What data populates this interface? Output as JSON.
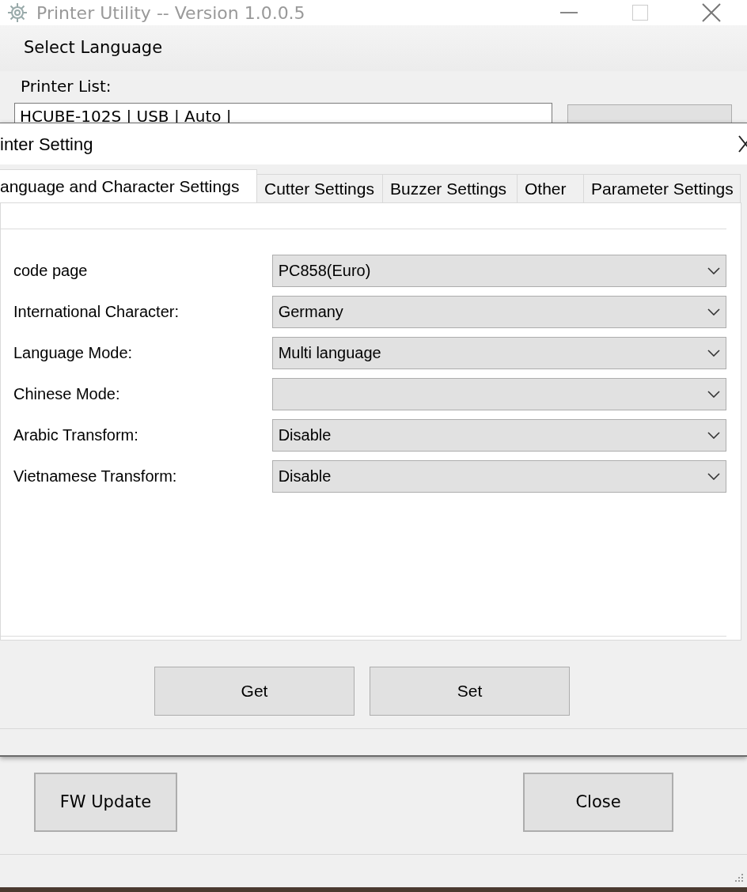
{
  "window": {
    "title": "Printer Utility -- Version 1.0.0.5"
  },
  "menu": [
    "Select Language"
  ],
  "printer_list": {
    "label": "Printer List:",
    "value": "HCUBE-102S | USB | Auto |"
  },
  "dialog": {
    "title": "inter Setting",
    "tabs": [
      {
        "label": "anguage and Character Settings",
        "selected": true
      },
      {
        "label": "Cutter Settings",
        "selected": false
      },
      {
        "label": "Buzzer Settings",
        "selected": false
      },
      {
        "label": "Other",
        "selected": false
      },
      {
        "label": "Parameter Settings",
        "selected": false
      }
    ],
    "settings": [
      {
        "label": "code page",
        "value": "PC858(Euro)"
      },
      {
        "label": "International Character:",
        "value": "Germany"
      },
      {
        "label": "Language Mode:",
        "value": "Multi language"
      },
      {
        "label": "Chinese Mode:"
      },
      {
        "label": "Arabic Transform:",
        "value": "Disable"
      },
      {
        "label": "Vietnamese Transform:",
        "value": "Disable"
      }
    ],
    "buttons": [
      "Get",
      "Set"
    ]
  },
  "buttons": [
    "FW Update",
    "Close"
  ]
}
